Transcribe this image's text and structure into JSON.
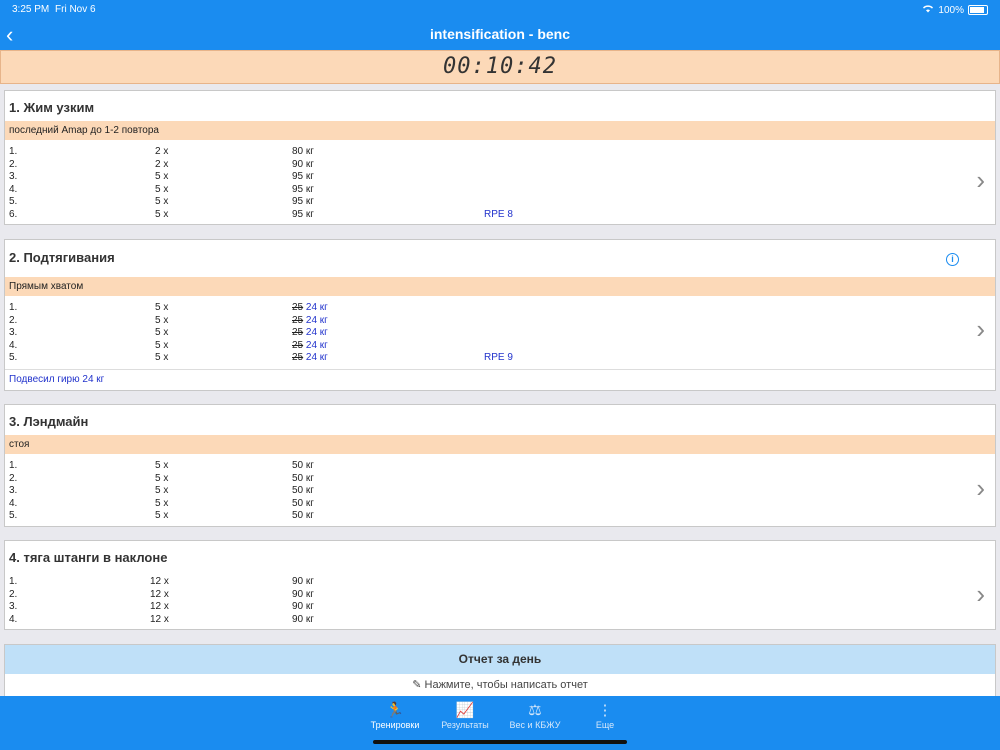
{
  "status": {
    "time": "3:25 PM",
    "date": "Fri Nov 6",
    "battery": "100%"
  },
  "nav": {
    "back_icon": "‹",
    "title": "intensification - benc"
  },
  "timer": "00:10:42",
  "exercises": [
    {
      "name": "1. Жим узким",
      "note": "последний Amap до 1-2 повтора",
      "sets": [
        {
          "n": "1.",
          "reps": "2 x",
          "weight": "80 кг",
          "rpe": ""
        },
        {
          "n": "2.",
          "reps": "2 x",
          "weight": "90 кг",
          "rpe": ""
        },
        {
          "n": "3.",
          "reps": "5 x",
          "weight": "95 кг",
          "rpe": ""
        },
        {
          "n": "4.",
          "reps": "5 x",
          "weight": "95 кг",
          "rpe": ""
        },
        {
          "n": "5.",
          "reps": "5 x",
          "weight": "95 кг",
          "rpe": ""
        },
        {
          "n": "6.",
          "reps": "5 x",
          "weight": "95 кг",
          "rpe": "RPE 8"
        }
      ]
    },
    {
      "name": "2. Подтягивания",
      "note": "Прямым хватом",
      "sets": [
        {
          "n": "1.",
          "reps": "5 x",
          "planned": "25",
          "weight": "24 кг",
          "rpe": ""
        },
        {
          "n": "2.",
          "reps": "5 x",
          "planned": "25",
          "weight": "24 кг",
          "rpe": ""
        },
        {
          "n": "3.",
          "reps": "5 x",
          "planned": "25",
          "weight": "24 кг",
          "rpe": ""
        },
        {
          "n": "4.",
          "reps": "5 x",
          "planned": "25",
          "weight": "24 кг",
          "rpe": ""
        },
        {
          "n": "5.",
          "reps": "5 x",
          "planned": "25",
          "weight": "24 кг",
          "rpe": "RPE 9"
        }
      ],
      "comment": "Подвесил гирю 24 кг"
    },
    {
      "name": "3. Лэндмайн",
      "note": "стоя",
      "sets": [
        {
          "n": "1.",
          "reps": "5 x",
          "weight": "50 кг"
        },
        {
          "n": "2.",
          "reps": "5 x",
          "weight": "50 кг"
        },
        {
          "n": "3.",
          "reps": "5 x",
          "weight": "50 кг"
        },
        {
          "n": "4.",
          "reps": "5 x",
          "weight": "50 кг"
        },
        {
          "n": "5.",
          "reps": "5 x",
          "weight": "50 кг"
        }
      ]
    },
    {
      "name": "4. тяга штанги в наклоне",
      "sets": [
        {
          "n": "1.",
          "reps": "12 x",
          "weight": "90 кг"
        },
        {
          "n": "2.",
          "reps": "12 x",
          "weight": "90 кг"
        },
        {
          "n": "3.",
          "reps": "12 x",
          "weight": "90 кг"
        },
        {
          "n": "4.",
          "reps": "12 x",
          "weight": "90 кг"
        }
      ]
    }
  ],
  "report": {
    "title": "Отчет за день",
    "prompt": "✎ Нажмите, чтобы написать отчет"
  },
  "tabs": [
    {
      "label": "Тренировки",
      "icon": "🏃"
    },
    {
      "label": "Результаты",
      "icon": "📈"
    },
    {
      "label": "Вес и КБЖУ",
      "icon": "⚖"
    },
    {
      "label": "Еще",
      "icon": "⋮"
    }
  ],
  "colors": {
    "accent": "#1a8cf0",
    "note_bg": "#fcd9b8",
    "report_header": "#bfe0f8"
  }
}
